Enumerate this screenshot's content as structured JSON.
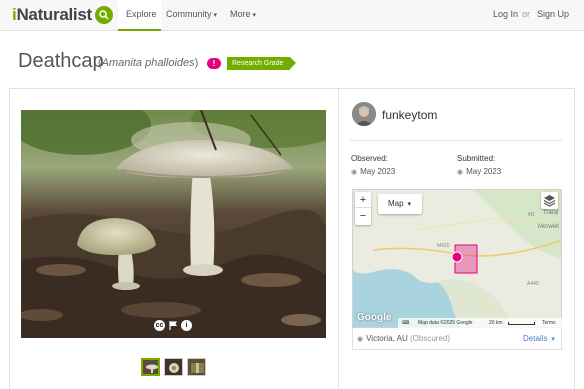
{
  "nav": {
    "logo_prefix": "i",
    "logo_rest": "Naturalist",
    "explore": "Explore",
    "community": "Community",
    "more": "More",
    "login": "Log In",
    "or": "or",
    "signup": "Sign Up"
  },
  "observation": {
    "common_name": "Deathcap",
    "scientific_name": "Amanita phalloides",
    "flag_badge": "!",
    "quality_badge": "Research Grade",
    "photo_icons": [
      "cc-icon",
      "flag-icon",
      "info-icon"
    ],
    "cc_glyph": "cc",
    "info_glyph": "i"
  },
  "user": {
    "username": "funkeytom"
  },
  "dates": {
    "observed_label": "Observed:",
    "observed_value": "May 2023",
    "submitted_label": "Submitted:",
    "submitted_value": "May 2023"
  },
  "map": {
    "zoom_in": "+",
    "zoom_out": "−",
    "type_label": "Map",
    "google": "Google",
    "attribution": "Map data ©2025 Google",
    "scale": "20 km",
    "terms": "Terms",
    "labels": {
      "a": "Morwell",
      "b": "Traral",
      "m1": "M1",
      "m420": "M420",
      "a440": "A440"
    },
    "marker_color": "#e6007e"
  },
  "location": {
    "place": "Victoria, AU",
    "status": "(Obscured)",
    "details_label": "Details"
  },
  "colors": {
    "accent": "#74ac00",
    "flag": "#e6007e",
    "link": "#4a7fc4"
  }
}
